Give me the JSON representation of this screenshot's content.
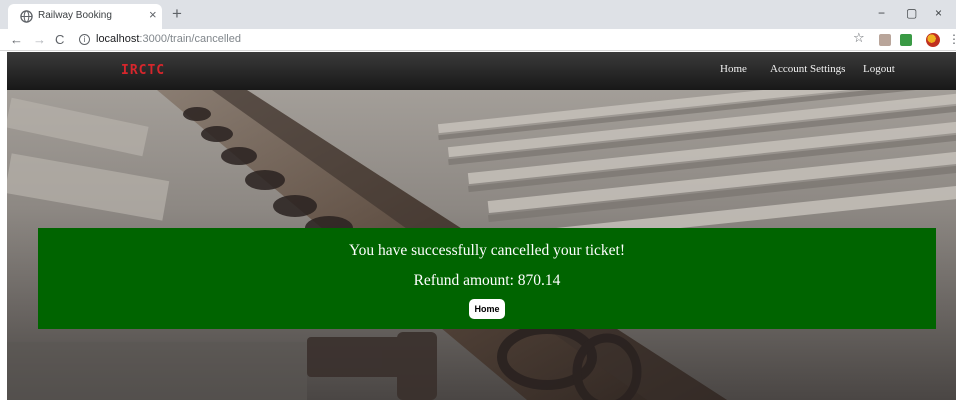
{
  "browser": {
    "tab_title": "Railway Booking",
    "tab_close": "×",
    "new_tab": "+",
    "window_controls": {
      "minimize": "−",
      "maximize": "▢",
      "close": "×"
    },
    "nav": {
      "back": "←",
      "forward": "→",
      "reload": "C",
      "info": "i"
    },
    "url_host": "localhost",
    "url_path": ":3000/train/cancelled",
    "bookmark_star": "☆",
    "menu": "⋮"
  },
  "navbar": {
    "brand": "IRCTC",
    "links": [
      "Home",
      "Account Settings",
      "Logout"
    ]
  },
  "result": {
    "message": "You have successfully cancelled your ticket!",
    "refund": "Refund amount: 870.14",
    "home_button": "Home"
  },
  "colors": {
    "banner": "#006400",
    "brand": "#d6262c"
  }
}
